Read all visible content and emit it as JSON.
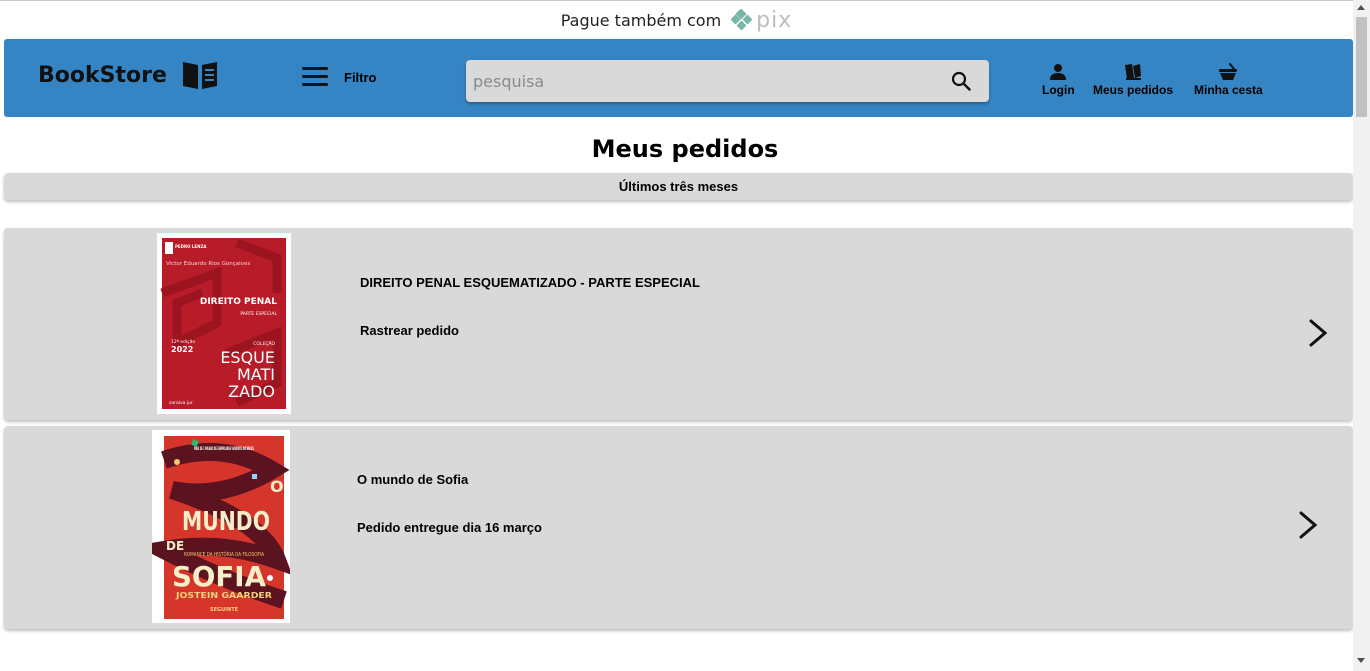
{
  "promo": {
    "text": "Pague também com",
    "pix_word": "pix"
  },
  "header": {
    "brand": "BookStore",
    "filter_label": "Filtro",
    "search_placeholder": "pesquisa",
    "nav": {
      "login": "Login",
      "orders": "Meus pedidos",
      "cart": "Minha cesta"
    },
    "background": "#3585c4"
  },
  "page": {
    "title": "Meus pedidos",
    "period": "Últimos três meses"
  },
  "orders": [
    {
      "title": "DIREITO PENAL ESQUEMATIZADO - PARTE ESPECIAL",
      "status": "Rastrear pedido",
      "cover": {
        "author": "Victor Eduardo Rios Gonçalves",
        "series_tag": "PEDRO LENZA",
        "book_title": "DIREITO PENAL",
        "subtitle": "PARTE ESPECIAL",
        "edition": "12ª edição",
        "year": "2022",
        "collection": "COLEÇÃO",
        "big_words": [
          "ESQUE",
          "MATI",
          "ZADO"
        ],
        "publisher": "saraiva jur"
      }
    },
    {
      "title": "O mundo de Sofia",
      "status": "Pedido entregue dia 16 março",
      "cover": {
        "tagline": "MAIS DE 1 MILHÃO DE EXEMPLARES VENDIDOS NO BRASIL",
        "o": "O",
        "mundo": "MUNDO",
        "de": "DE",
        "sofia": "SOFIA",
        "subtitle": "ROMANCE DA HISTÓRIA DA FILOSOFIA",
        "author": "JOSTEIN GAARDER",
        "publisher": "SEGUINTE"
      }
    }
  ]
}
